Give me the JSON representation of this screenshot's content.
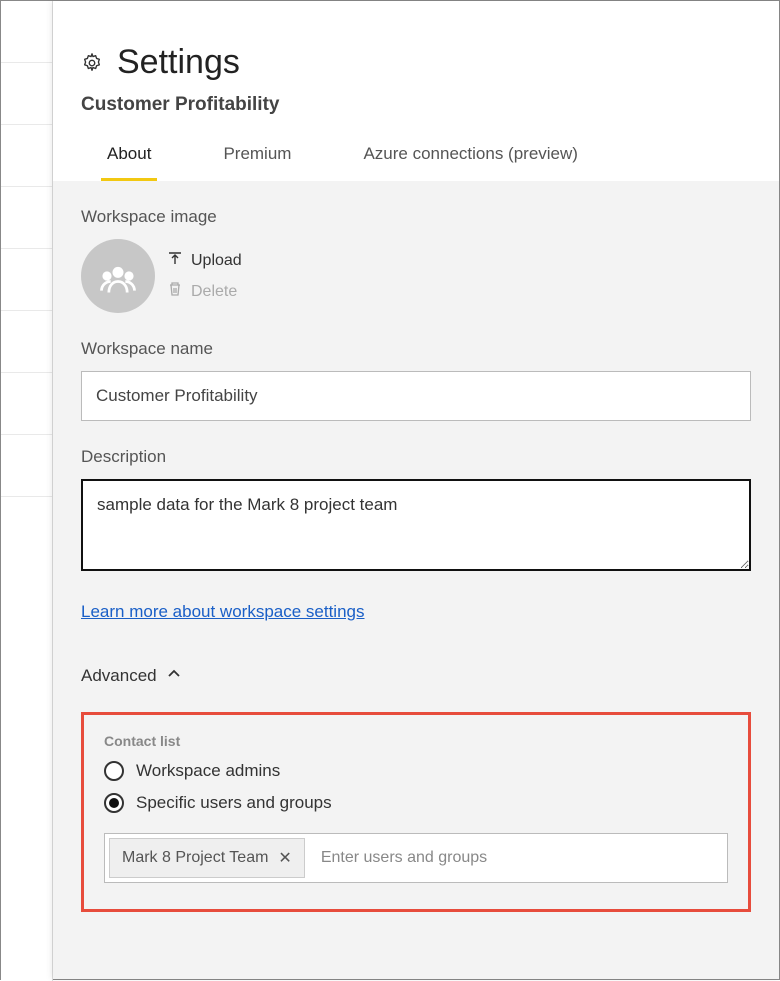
{
  "header": {
    "title": "Settings",
    "subtitle": "Customer Profitability"
  },
  "tabs": [
    {
      "label": "About",
      "active": true
    },
    {
      "label": "Premium",
      "active": false
    },
    {
      "label": "Azure connections (preview)",
      "active": false
    }
  ],
  "workspaceImage": {
    "sectionLabel": "Workspace image",
    "uploadLabel": "Upload",
    "deleteLabel": "Delete"
  },
  "workspaceName": {
    "label": "Workspace name",
    "value": "Customer Profitability"
  },
  "description": {
    "label": "Description",
    "value": "sample data for the Mark 8 project team"
  },
  "learnMoreLink": "Learn more about workspace settings",
  "advanced": {
    "label": "Advanced"
  },
  "contactList": {
    "label": "Contact list",
    "options": {
      "admins": "Workspace admins",
      "specific": "Specific users and groups"
    },
    "selected": "specific",
    "chip": "Mark 8 Project Team",
    "placeholder": "Enter users and groups"
  }
}
